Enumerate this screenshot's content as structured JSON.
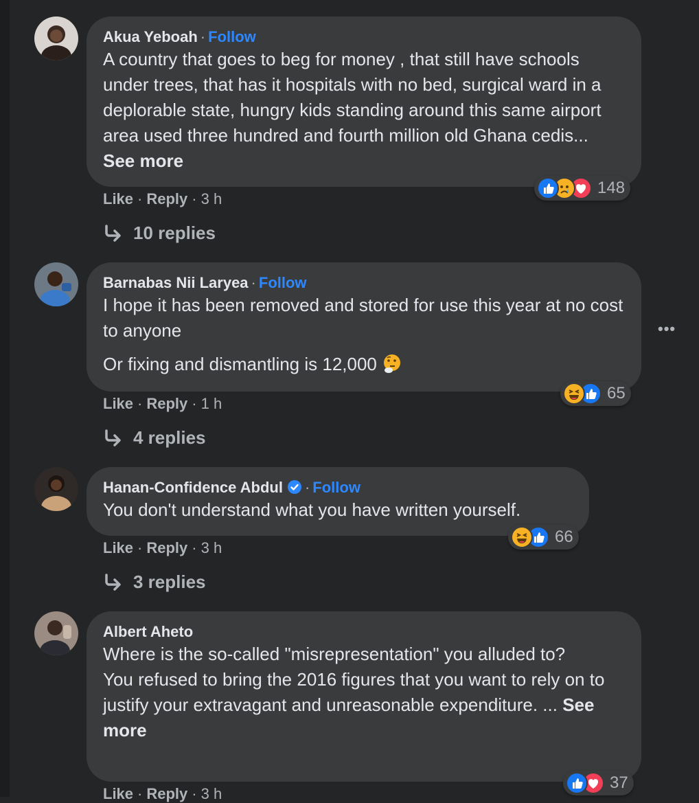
{
  "comments": [
    {
      "author": "Akua Yeboah",
      "follow": "Follow",
      "lines": [
        "A country that goes to beg for money , that still have schools under trees, that has it hospitals with no bed, surgical ward in a deplorable state, hungry kids standing around this same airport area used three hundred and fourth million old Ghana cedis..."
      ],
      "see_more": "See more",
      "like": "Like",
      "reply": "Reply",
      "time": "3 h",
      "reaction_count": "148",
      "reaction_icons": [
        "like-icon",
        "sad-icon",
        "love-icon"
      ],
      "replies": "10 replies"
    },
    {
      "author": "Barnabas Nii Laryea",
      "follow": "Follow",
      "para1": "I hope it has been removed and stored for use this year at no cost to anyone",
      "para2": "Or fixing and dismantling is 12,000",
      "inline_emoji": "thinking-face-icon",
      "like": "Like",
      "reply": "Reply",
      "time": "1 h",
      "reaction_count": "65",
      "reaction_icons": [
        "haha-icon",
        "like-icon"
      ],
      "replies": "4 replies"
    },
    {
      "author": "Hanan-Confidence Abdul",
      "follow": "Follow",
      "text": "You don't understand what you have written yourself.",
      "like": "Like",
      "reply": "Reply",
      "time": "3 h",
      "reaction_count": "66",
      "reaction_icons": [
        "haha-icon",
        "like-icon"
      ],
      "replies": "3 replies"
    },
    {
      "author": "Albert Aheto",
      "text1": "Where is the so-called \"misrepresentation\" you alluded to?",
      "text2": "You refused to bring the 2016 figures that you want to rely on to justify your extravagant and unreasonable expenditure. ...",
      "see_more": "See more",
      "like": "Like",
      "reply": "Reply",
      "time": "3 h",
      "reaction_count": "37",
      "reaction_icons": [
        "like-icon",
        "love-icon"
      ]
    }
  ],
  "more_menu": "•••",
  "colors": {
    "background": "#242526",
    "bubble": "#3a3b3c",
    "follow": "#2d88ff",
    "muted": "#b0b3b8",
    "like_blue": "#1877f2",
    "love_red": "#f33e58",
    "haha_yellow": "#f7b125"
  }
}
